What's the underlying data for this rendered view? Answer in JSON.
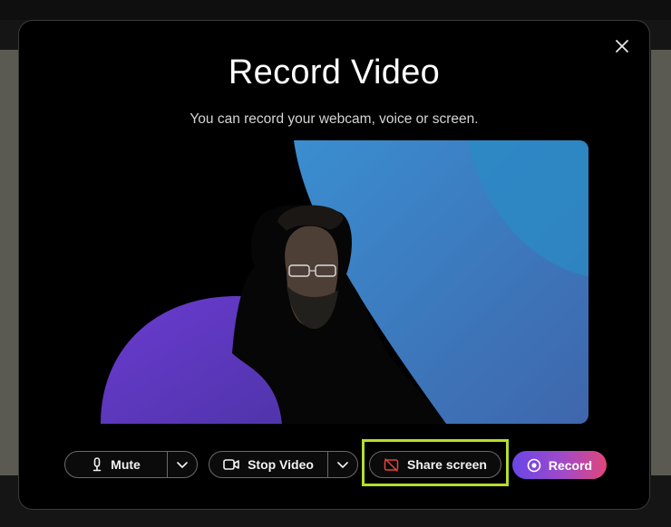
{
  "dialog": {
    "title": "Record Video",
    "subtitle": "You can record your webcam, voice or screen."
  },
  "controls": {
    "mute_label": "Mute",
    "stop_video_label": "Stop Video",
    "share_screen_label": "Share screen",
    "record_label": "Record"
  },
  "icons": {
    "close": "close-icon",
    "microphone": "microphone-icon",
    "camera": "video-camera-icon",
    "share": "screen-share-off-icon",
    "record": "record-icon",
    "chevron": "chevron-down-icon"
  },
  "colors": {
    "highlight": "#b6dd2c",
    "record_gradient_start": "#6a46e6",
    "record_gradient_end": "#e0467a",
    "share_icon": "#e0453a"
  }
}
